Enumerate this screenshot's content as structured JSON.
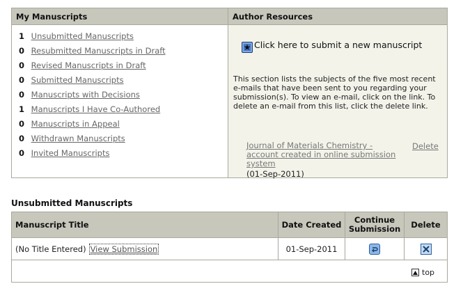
{
  "my_manuscripts": {
    "header": "My Manuscripts",
    "items": [
      {
        "count": "1",
        "label": "Unsubmitted Manuscripts"
      },
      {
        "count": "0",
        "label": "Resubmitted Manuscripts in Draft"
      },
      {
        "count": "0",
        "label": "Revised Manuscripts in Draft"
      },
      {
        "count": "0",
        "label": "Submitted Manuscripts"
      },
      {
        "count": "0",
        "label": "Manuscripts with Decisions"
      },
      {
        "count": "1",
        "label": "Manuscripts I Have Co-Authored"
      },
      {
        "count": "0",
        "label": "Manuscripts in Appeal"
      },
      {
        "count": "0",
        "label": "Withdrawn Manuscripts"
      },
      {
        "count": "0",
        "label": "Invited Manuscripts"
      }
    ]
  },
  "author_resources": {
    "header": "Author Resources",
    "submit_prefix": "Click ",
    "submit_link": "here",
    "submit_suffix": " to submit a new manuscript",
    "description": "This section lists the subjects of the five most recent e-mails that have been sent to you regarding your submission(s). To view an e-mail, click on the link. To delete an e-mail from this list, click the delete link.",
    "email": {
      "subject": "Journal of Materials Chemistry - account created in online submission system",
      "date": "(01-Sep-2011)",
      "delete_label": "Delete"
    }
  },
  "unsubmitted": {
    "title": "Unsubmitted Manuscripts",
    "columns": {
      "title": "Manuscript Title",
      "date": "Date Created",
      "continue": "Continue Submission",
      "delete": "Delete"
    },
    "rows": [
      {
        "title": "(No Title Entered)",
        "view_label": "View Submission",
        "date": "01-Sep-2011"
      }
    ],
    "top_label": "top"
  },
  "icons": {
    "star": "star-icon",
    "continue": "continue-arrow-icon",
    "delete": "delete-x-icon",
    "top": "up-arrow-icon"
  }
}
